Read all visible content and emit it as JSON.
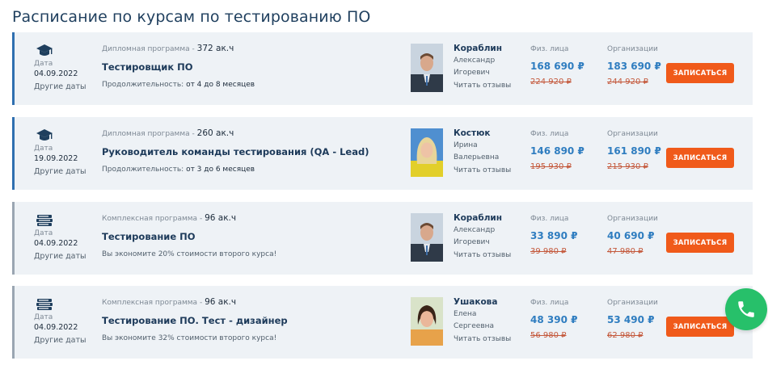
{
  "page": {
    "title": "Расписание по курсам по тестированию ПО"
  },
  "common": {
    "date_label": "Дата",
    "other_dates": "Другие даты",
    "individuals_label": "Физ. лица",
    "organizations_label": "Организации",
    "read_reviews": "Читать отзывы",
    "enroll_label": "ЗАПИСАТЬСЯ"
  },
  "courses": [
    {
      "date": "04.09.2022",
      "program_type": "Дипломная программа",
      "hours": "372 ак.ч",
      "title": "Тестировщик ПО",
      "note_prefix": "Продолжительность:",
      "note_value": "от 4 до 8 месяцев",
      "teacher": {
        "last": "Кораблин",
        "first": "Александр",
        "middle": "Игоревич"
      },
      "price_individual": "168 690 ₽",
      "price_individual_old": "224 920 ₽",
      "price_org": "183 690 ₽",
      "price_org_old": "244 920 ₽"
    },
    {
      "date": "19.09.2022",
      "program_type": "Дипломная программа",
      "hours": "260 ак.ч",
      "title": "Руководитель команды тестирования (QA - Lead)",
      "note_prefix": "Продолжительность:",
      "note_value": "от 3 до 6 месяцев",
      "teacher": {
        "last": "Костюк",
        "first": "Ирина",
        "middle": "Валерьевна"
      },
      "price_individual": "146 890 ₽",
      "price_individual_old": "195 930 ₽",
      "price_org": "161 890 ₽",
      "price_org_old": "215 930 ₽"
    },
    {
      "date": "04.09.2022",
      "program_type": "Комплексная программа",
      "hours": "96 ак.ч",
      "title": "Тестирование ПО",
      "note_prefix": "Вы экономите 20% стоимости второго курса!",
      "note_value": "",
      "teacher": {
        "last": "Кораблин",
        "first": "Александр",
        "middle": "Игоревич"
      },
      "price_individual": "33 890 ₽",
      "price_individual_old": "39 980 ₽",
      "price_org": "40 690 ₽",
      "price_org_old": "47 980 ₽"
    },
    {
      "date": "04.09.2022",
      "program_type": "Комплексная программа",
      "hours": "96 ак.ч",
      "title": "Тестирование ПО. Тест - дизайнер",
      "note_prefix": "Вы экономите 32% стоимости второго курса!",
      "note_value": "",
      "teacher": {
        "last": "Ушакова",
        "first": "Елена",
        "middle": "Сергеевна"
      },
      "price_individual": "48 390 ₽",
      "price_individual_old": "56 980 ₽",
      "price_org": "53 490 ₽",
      "price_org_old": "62 980 ₽"
    }
  ],
  "icons": {
    "diploma": "graduation-cap-icon",
    "complex": "books-stack-icon",
    "call": "phone-icon"
  },
  "colors": {
    "accent": "#2f7dc0",
    "button": "#f05a1a",
    "old_price": "#c4593c",
    "call": "#27c06a",
    "card_bg": "#eef2f6"
  }
}
